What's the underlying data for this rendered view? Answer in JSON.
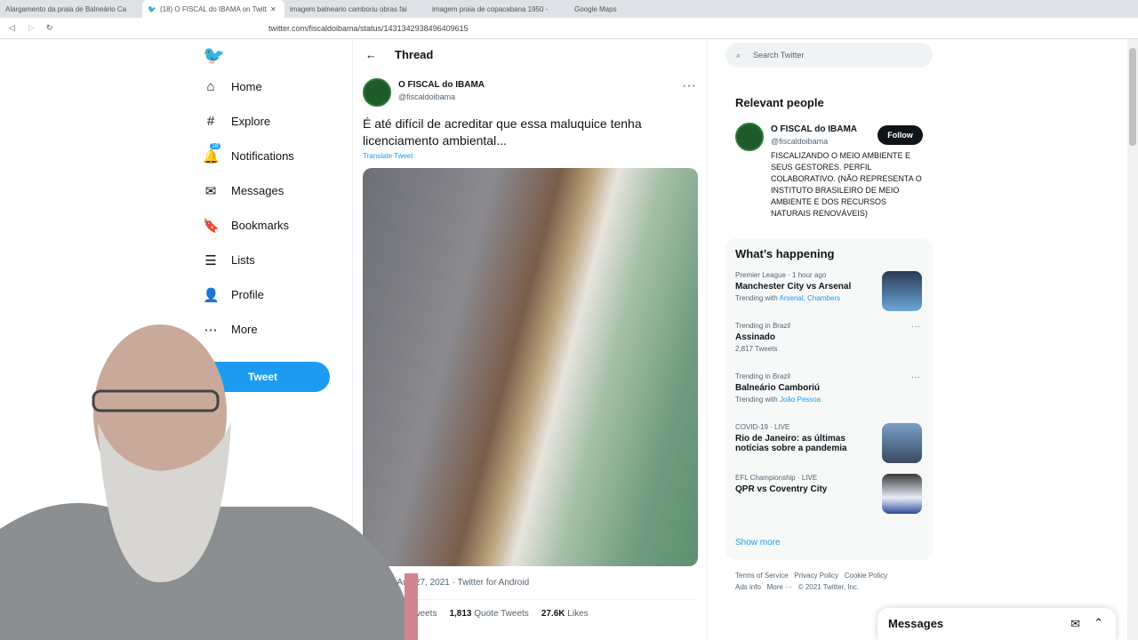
{
  "browser": {
    "tabs": [
      {
        "label": "Alargamento da praia de Balneário Ca"
      },
      {
        "label": "(18) O FISCAL do IBAMA on Twitt"
      },
      {
        "label": "imagem balneario camboriu obras fai"
      },
      {
        "label": "imagem praia de copacabana 1950 -"
      },
      {
        "label": "Google Maps"
      }
    ],
    "url": "twitter.com/fiscaldoibama/status/1431342938496409615"
  },
  "nav": {
    "items": [
      {
        "label": "Home",
        "icon": "home-icon"
      },
      {
        "label": "Explore",
        "icon": "hash-icon"
      },
      {
        "label": "Notifications",
        "icon": "bell-icon",
        "badge": "18"
      },
      {
        "label": "Messages",
        "icon": "mail-icon"
      },
      {
        "label": "Bookmarks",
        "icon": "bookmark-icon"
      },
      {
        "label": "Lists",
        "icon": "list-icon"
      },
      {
        "label": "Profile",
        "icon": "person-icon"
      },
      {
        "label": "More",
        "icon": "more-icon"
      }
    ],
    "tweet": "Tweet"
  },
  "thread": {
    "title": "Thread",
    "author": "O FISCAL do IBAMA",
    "handle": "@fiscaldoibama",
    "text": "É até difícil de acreditar que essa maluquice tenha licenciamento ambiental...",
    "translate": "Translate Tweet",
    "meta": "PM · Aug 27, 2021 · Twitter for Android",
    "stats": {
      "retweets_label": "etweets",
      "quote_count": "1,813",
      "quote_label": "Quote Tweets",
      "likes_count": "27.6K",
      "likes_label": "Likes"
    }
  },
  "sidebar": {
    "search_placeholder": "Search Twitter",
    "relevant": {
      "title": "Relevant people",
      "name": "O FISCAL do IBAMA",
      "handle": "@fiscaldoibama",
      "follow": "Follow",
      "bio": "FISCALIZANDO O MEIO AMBIENTE E SEUS GESTORES. PERFIL COLABORATIVO. (NÃO REPRESENTA O INSTITUTO BRASILEIRO DE MEIO AMBIENTE E DOS RECURSOS NATURAIS RENOVÁVEIS)"
    },
    "happening": {
      "title": "What’s happening",
      "trends": [
        {
          "meta": "Premier League · 1 hour ago",
          "title": "Manchester City vs Arsenal",
          "sub": "Trending with ",
          "links": "Arsenal, Chambers"
        },
        {
          "meta": "Trending in Brazil",
          "title": "Assinado",
          "sub": "2,817 Tweets",
          "links": ""
        },
        {
          "meta": "Trending in Brazil",
          "title": "Balneário Camboriú",
          "sub": "Trending with ",
          "links": "João Pessoa"
        },
        {
          "meta": "COVID-19 · LIVE",
          "title": "Rio de Janeiro: as últimas notícias sobre a pandemia",
          "sub": "",
          "links": ""
        },
        {
          "meta": "EFL Championship · LIVE",
          "title": "QPR vs Coventry City",
          "sub": "",
          "links": ""
        }
      ],
      "show_more": "Show more"
    },
    "footer": [
      "Terms of Service",
      "Privacy Policy",
      "Cookie Policy",
      "Ads info",
      "More ···",
      "© 2021 Twitter, Inc."
    ]
  },
  "messages": {
    "title": "Messages"
  }
}
